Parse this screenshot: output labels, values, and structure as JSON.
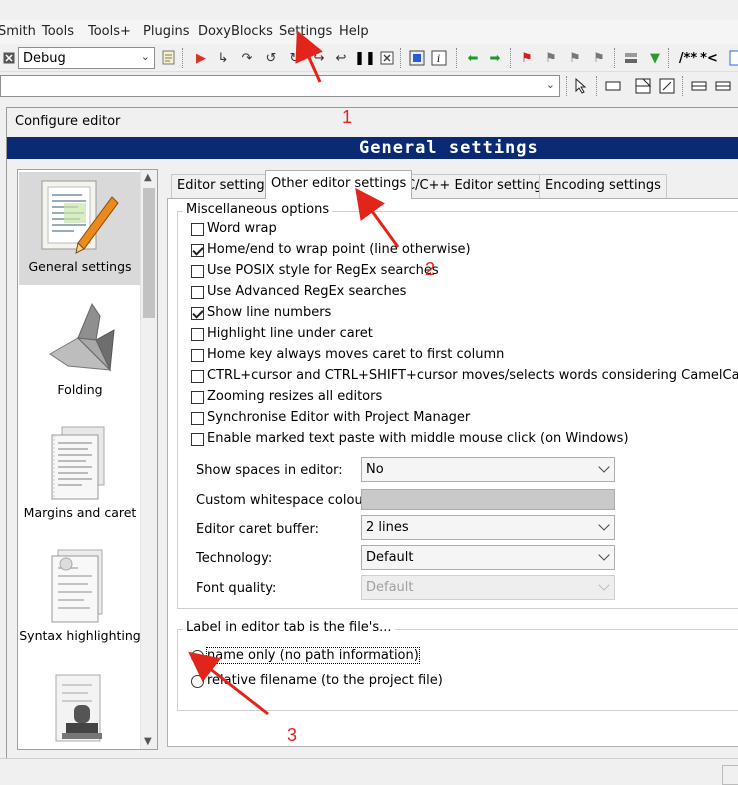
{
  "menu": {
    "items": [
      "Smith",
      "Tools",
      "Tools+",
      "Plugins",
      "DoxyBlocks",
      "Settings",
      "Help"
    ]
  },
  "toolbar": {
    "build_target": "Debug",
    "comment_label": "/**",
    "comment_label_2": "*<"
  },
  "dialog": {
    "title": "Configure editor",
    "header": "General settings"
  },
  "categories": [
    {
      "label": "General settings",
      "selected": true,
      "icon": "pencil-document-icon"
    },
    {
      "label": "Folding",
      "selected": false,
      "icon": "origami-icon"
    },
    {
      "label": "Margins and caret",
      "selected": false,
      "icon": "pages-icon"
    },
    {
      "label": "Syntax highlighting",
      "selected": false,
      "icon": "highlight-page-icon"
    },
    {
      "label": "",
      "selected": false,
      "icon": "stamp-icon"
    }
  ],
  "tabs": [
    {
      "label": "Editor settings",
      "active": false
    },
    {
      "label": "Other editor settings",
      "active": true
    },
    {
      "label": "C/C++ Editor settings",
      "active": false
    },
    {
      "label": "Encoding settings",
      "active": false
    }
  ],
  "misc": {
    "title": "Miscellaneous options",
    "options": [
      {
        "label": "Word wrap",
        "checked": false
      },
      {
        "label": "Home/end to wrap point (line otherwise)",
        "checked": true
      },
      {
        "label": "Use POSIX style for RegEx searches",
        "checked": false
      },
      {
        "label": "Use Advanced RegEx searches",
        "checked": false
      },
      {
        "label": "Show line numbers",
        "checked": true
      },
      {
        "label": "Highlight line under caret",
        "checked": false
      },
      {
        "label": "Home key always moves caret to first column",
        "checked": false
      },
      {
        "label": "CTRL+cursor and CTRL+SHIFT+cursor moves/selects words considering CamelCase",
        "checked": false
      },
      {
        "label": "Zooming resizes all editors",
        "checked": false
      },
      {
        "label": "Synchronise Editor with Project Manager",
        "checked": false
      },
      {
        "label": "Enable marked text paste with middle mouse click (on Windows)",
        "checked": false
      }
    ]
  },
  "fields": {
    "show_spaces": {
      "label": "Show spaces in editor:",
      "value": "No"
    },
    "whitespace_colour": {
      "label": "Custom whitespace colour:",
      "color": "#c9c9c9"
    },
    "caret_buffer": {
      "label": "Editor caret buffer:",
      "value": "2 lines"
    },
    "technology": {
      "label": "Technology:",
      "value": "Default"
    },
    "font_quality": {
      "label": "Font quality:",
      "value": "Default",
      "disabled": true
    }
  },
  "tab_label_group": {
    "title": "Label in editor tab is the file's...",
    "options": [
      {
        "label": "name only (no path information)",
        "selected": true
      },
      {
        "label": "relative filename (to the project file)",
        "selected": false
      }
    ]
  },
  "annotations": [
    "1",
    "2",
    "3"
  ],
  "colors": {
    "header_band": "#0a2a73",
    "annotation_red": "#e1251b",
    "selected_category": "#d9d9d9"
  }
}
